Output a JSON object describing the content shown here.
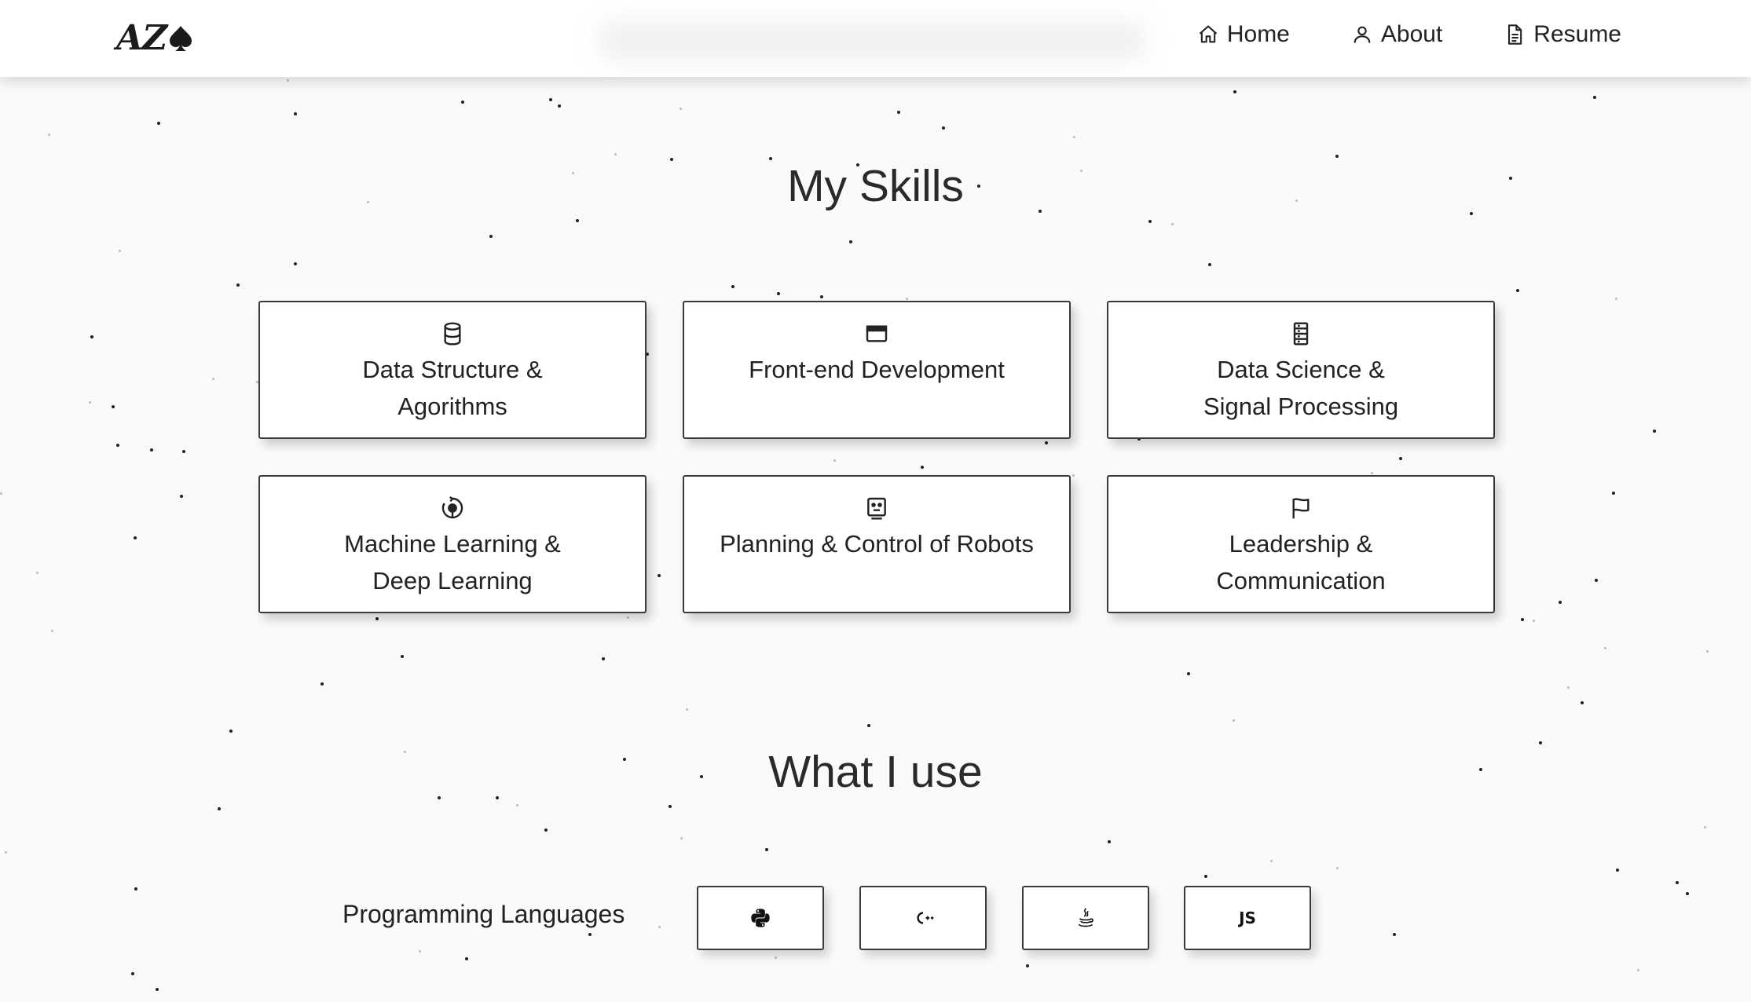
{
  "navbar": {
    "logo_text": "AZ",
    "links": [
      {
        "label": "Home",
        "icon": "home-icon"
      },
      {
        "label": "About",
        "icon": "user-icon"
      },
      {
        "label": "Resume",
        "icon": "document-icon"
      }
    ]
  },
  "skills": {
    "title": "My Skills",
    "cards": [
      {
        "label": "Data Structure &\nAgorithms",
        "icon": "database-icon"
      },
      {
        "label": "Front-end Development",
        "icon": "browser-window-icon"
      },
      {
        "label": "Data Science &\nSignal Processing",
        "icon": "server-icon"
      },
      {
        "label": "Machine Learning &\nDeep Learning",
        "icon": "brain-icon"
      },
      {
        "label": "Planning & Control of Robots",
        "icon": "robot-icon"
      },
      {
        "label": "Leadership &\nCommunication",
        "icon": "flag-icon"
      }
    ]
  },
  "tools": {
    "title": "What I use",
    "row_label": "Programming Languages",
    "items": [
      {
        "name": "Python",
        "icon": "python-icon"
      },
      {
        "name": "C++",
        "icon": "cplusplus-icon"
      },
      {
        "name": "Java",
        "icon": "java-icon"
      },
      {
        "name": "JavaScript",
        "icon": "javascript-icon",
        "text": "JS"
      }
    ]
  },
  "colors": {
    "background": "#fafafa",
    "card_border": "#3a3a3a",
    "text": "#222222"
  }
}
